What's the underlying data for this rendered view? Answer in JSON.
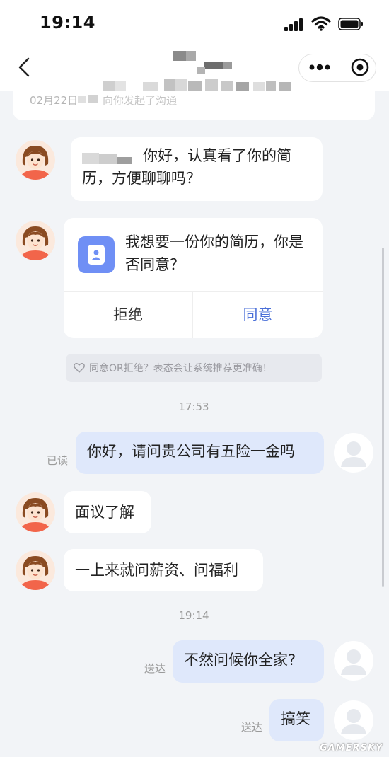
{
  "status_bar": {
    "time": "19:14"
  },
  "nav": {
    "back_icon": "chevron-left-icon",
    "more_icon": "more-dots-icon",
    "close_icon": "target-circle-icon"
  },
  "top_card": {
    "date": "02月22日",
    "text_tail": "向你发起了沟通"
  },
  "messages": {
    "m1_text": "你好，认真看了你的简历，方便聊聊吗？",
    "resume_request": {
      "text": "我想要一份你的简历，你是否同意？",
      "reject_label": "拒绝",
      "agree_label": "同意"
    },
    "hint": "同意OR拒绝？表态会让系统推荐更准确！",
    "time1": "17:53",
    "m2_text": "你好，请问贵公司有五险一金吗",
    "m2_state": "已读",
    "m3_text": "面议了解",
    "m4_text": "一上来就问薪资、问福利",
    "time2": "19:14",
    "m5_text": "不然问候你全家?",
    "m5_state": "送达",
    "m6_text": "搞笑",
    "m6_state": "送达"
  },
  "watermark": "GAMERSKY",
  "colors": {
    "accent": "#4a6fd8",
    "outgoing_bubble": "#dfe8fb",
    "background": "#f2f4f7",
    "resume_icon": "#6f8ff5"
  }
}
